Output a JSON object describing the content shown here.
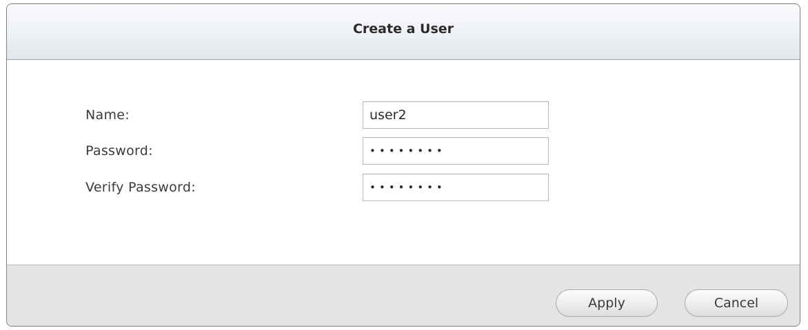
{
  "dialog": {
    "title": "Create a User"
  },
  "form": {
    "name_label": "Name:",
    "name_value": "user2",
    "password_label": "Password:",
    "password_value": "••••••••",
    "verify_label": "Verify Password:",
    "verify_value": "••••••••"
  },
  "buttons": {
    "apply": "Apply",
    "cancel": "Cancel"
  }
}
